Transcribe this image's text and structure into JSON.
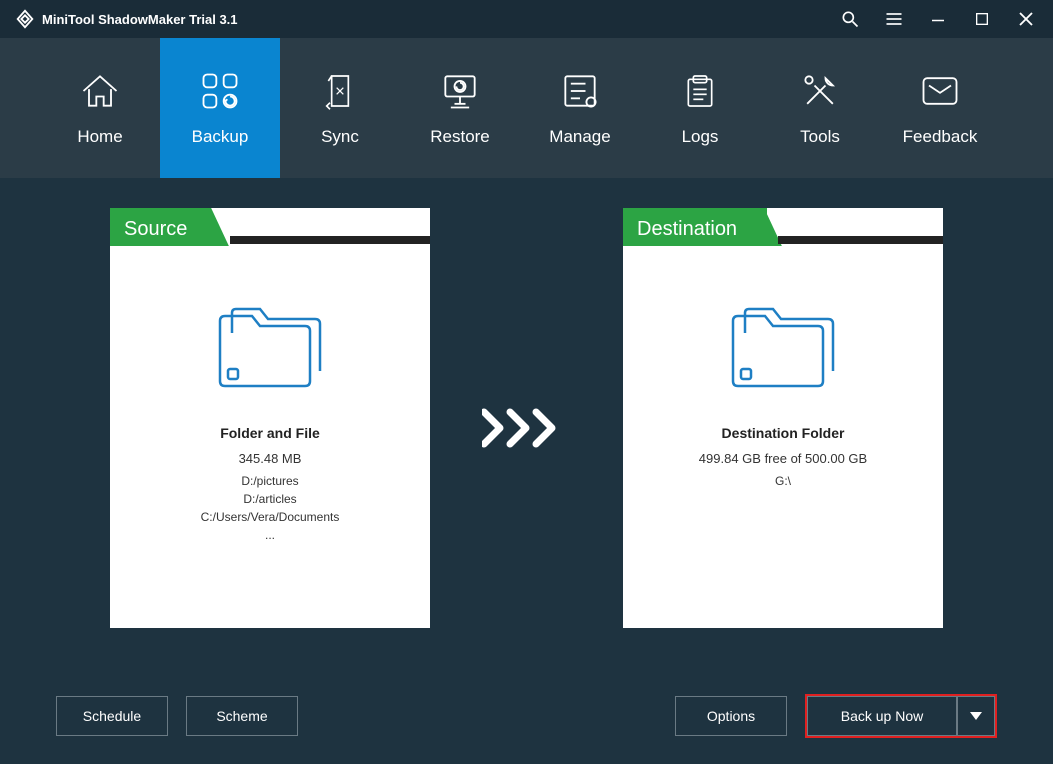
{
  "app": {
    "title": "MiniTool ShadowMaker Trial 3.1"
  },
  "nav": {
    "items": [
      {
        "label": "Home"
      },
      {
        "label": "Backup"
      },
      {
        "label": "Sync"
      },
      {
        "label": "Restore"
      },
      {
        "label": "Manage"
      },
      {
        "label": "Logs"
      },
      {
        "label": "Tools"
      },
      {
        "label": "Feedback"
      }
    ],
    "active_index": 1
  },
  "source": {
    "header": "Source",
    "title": "Folder and File",
    "size": "345.48 MB",
    "paths": [
      "D:/pictures",
      "D:/articles",
      "C:/Users/Vera/Documents"
    ],
    "more": "..."
  },
  "destination": {
    "header": "Destination",
    "title": "Destination Folder",
    "free": "499.84 GB free of 500.00 GB",
    "drive": "G:\\"
  },
  "buttons": {
    "schedule": "Schedule",
    "scheme": "Scheme",
    "options": "Options",
    "backup_now": "Back up Now"
  }
}
